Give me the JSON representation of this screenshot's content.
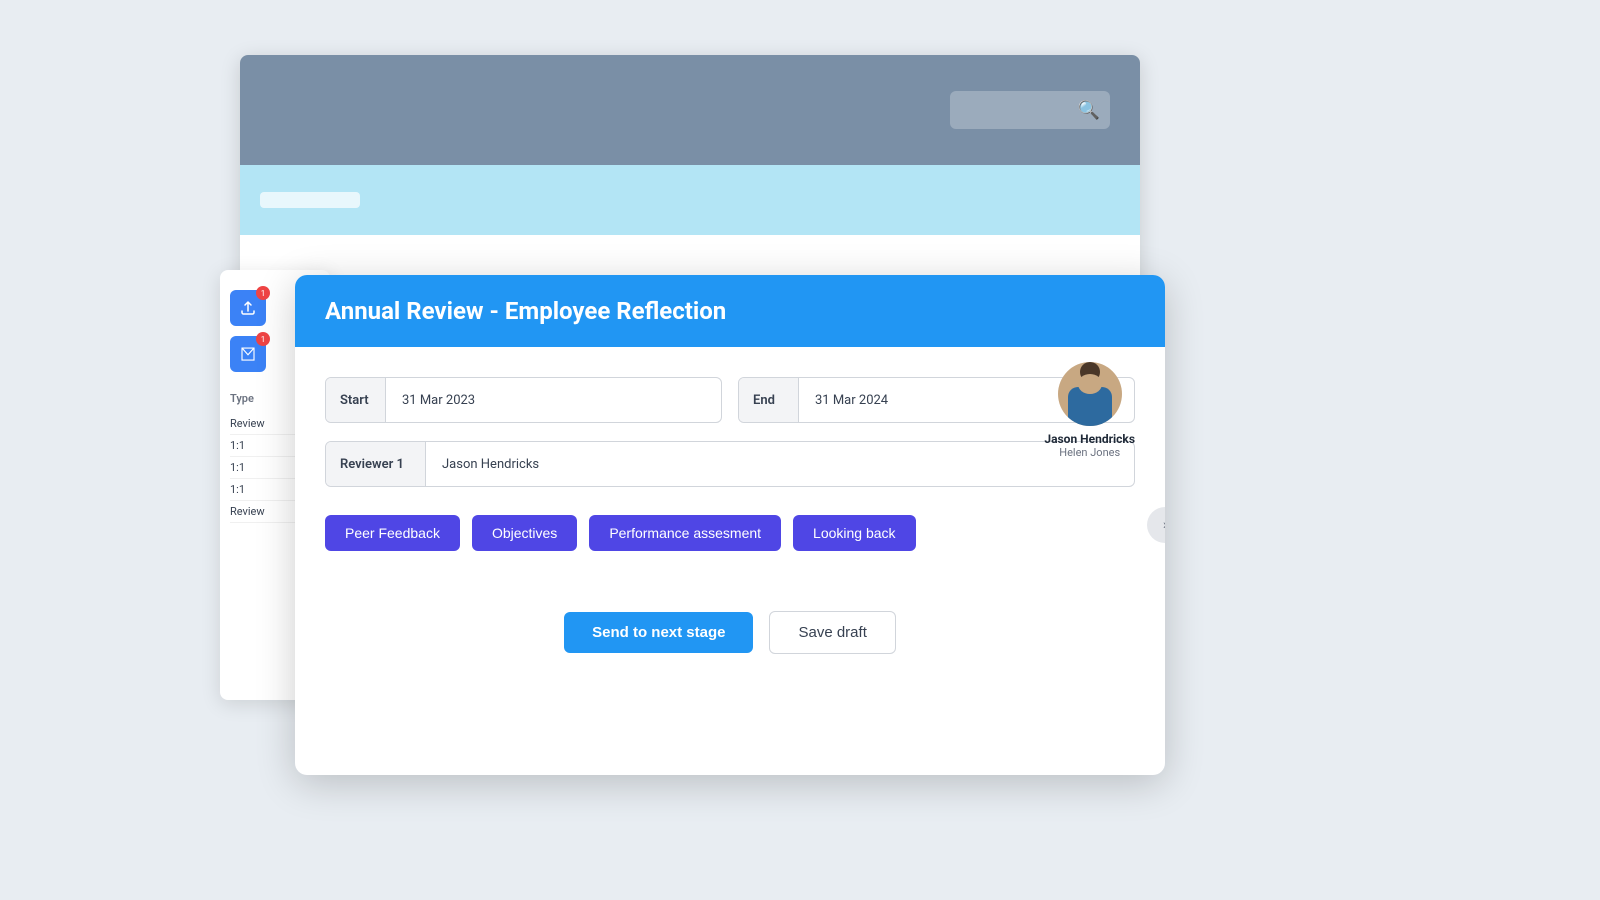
{
  "bgWindow": {
    "searchPlaceholder": ""
  },
  "sidebar": {
    "typeLabel": "Type",
    "items": [
      {
        "label": "Review"
      },
      {
        "label": "1:1"
      },
      {
        "label": "1:1"
      },
      {
        "label": "1:1"
      },
      {
        "label": "Review"
      }
    ]
  },
  "modal": {
    "title": "Annual Review - Employee Reflection",
    "startLabel": "Start",
    "startValue": "31 Mar 2023",
    "endLabel": "End",
    "endValue": "31 Mar 2024",
    "reviewerLabel": "Reviewer 1",
    "reviewerValue": "Jason Hendricks",
    "tags": [
      "Peer Feedback",
      "Objectives",
      "Performance assesment",
      "Looking back"
    ],
    "avatarName": "Jason Hendricks",
    "avatarSub": "Helen Jones",
    "sendToNextStageLabel": "Send to next stage",
    "saveDraftLabel": "Save draft"
  }
}
